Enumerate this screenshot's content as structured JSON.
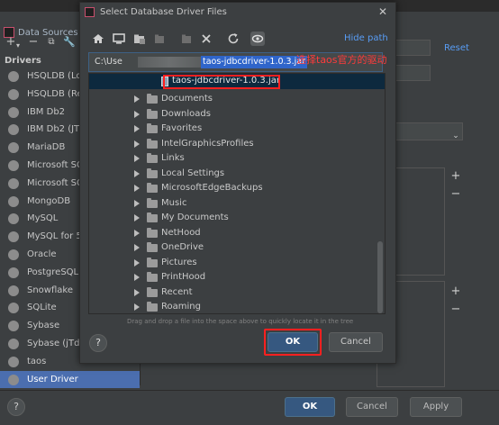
{
  "background_window": {
    "title": "Data Sources a",
    "drivers_header": "Drivers",
    "reset_label": "Reset",
    "drivers": [
      {
        "label": "HSQLDB (Lo",
        "icon": "hsqldb-icon"
      },
      {
        "label": "HSQLDB (Re",
        "icon": "hsqldb-icon"
      },
      {
        "label": "IBM Db2",
        "icon": "ibm-icon"
      },
      {
        "label": "IBM Db2 (JT",
        "icon": "ibm-icon"
      },
      {
        "label": "MariaDB",
        "icon": "mariadb-icon"
      },
      {
        "label": "Microsoft SC",
        "icon": "mssql-icon"
      },
      {
        "label": "Microsoft SC",
        "icon": "mssql-icon"
      },
      {
        "label": "MongoDB",
        "icon": "mongodb-icon"
      },
      {
        "label": "MySQL",
        "icon": "mysql-icon"
      },
      {
        "label": "MySQL for 5.",
        "icon": "mysql-icon"
      },
      {
        "label": "Oracle",
        "icon": "oracle-icon"
      },
      {
        "label": "PostgreSQL",
        "icon": "postgresql-icon"
      },
      {
        "label": "Snowflake",
        "icon": "snowflake-icon"
      },
      {
        "label": "SQLite",
        "icon": "sqlite-icon"
      },
      {
        "label": "Sybase",
        "icon": "sybase-icon"
      },
      {
        "label": "Sybase (jTds)",
        "icon": "sybase-icon"
      },
      {
        "label": "taos",
        "icon": "driver-icon"
      },
      {
        "label": "User Driver",
        "icon": "driver-icon",
        "selected": true
      }
    ],
    "buttons": {
      "ok": "OK",
      "cancel": "Cancel",
      "apply": "Apply",
      "help": "?"
    }
  },
  "dialog": {
    "title": "Select Database Driver Files",
    "hide_path_label": "Hide path",
    "path_prefix": "C:\\Use",
    "path_selected": "taos-jdbcdriver-1.0.3.jar",
    "annotation": "选择taos官方的驱动",
    "selected_file": "taos-jdbcdriver-1.0.3.jar",
    "tree_items": [
      "Documents",
      "Downloads",
      "Favorites",
      "IntelGraphicsProfiles",
      "Links",
      "Local Settings",
      "MicrosoftEdgeBackups",
      "Music",
      "My Documents",
      "NetHood",
      "OneDrive",
      "Pictures",
      "PrintHood",
      "Recent",
      "Roaming"
    ],
    "drag_hint": "Drag and drop a file into the space above to quickly locate it in the tree",
    "buttons": {
      "ok": "OK",
      "cancel": "Cancel",
      "help": "?"
    },
    "toolbar_icons": [
      "home-icon",
      "desktop-icon",
      "project-icon",
      "module-icon",
      "new-folder-icon",
      "delete-icon",
      "refresh-icon",
      "show-hidden-icon"
    ]
  },
  "colors": {
    "accent": "#589df6",
    "selection": "#4b6eaf",
    "annotation": "#ff2020",
    "primary_button": "#365880"
  }
}
